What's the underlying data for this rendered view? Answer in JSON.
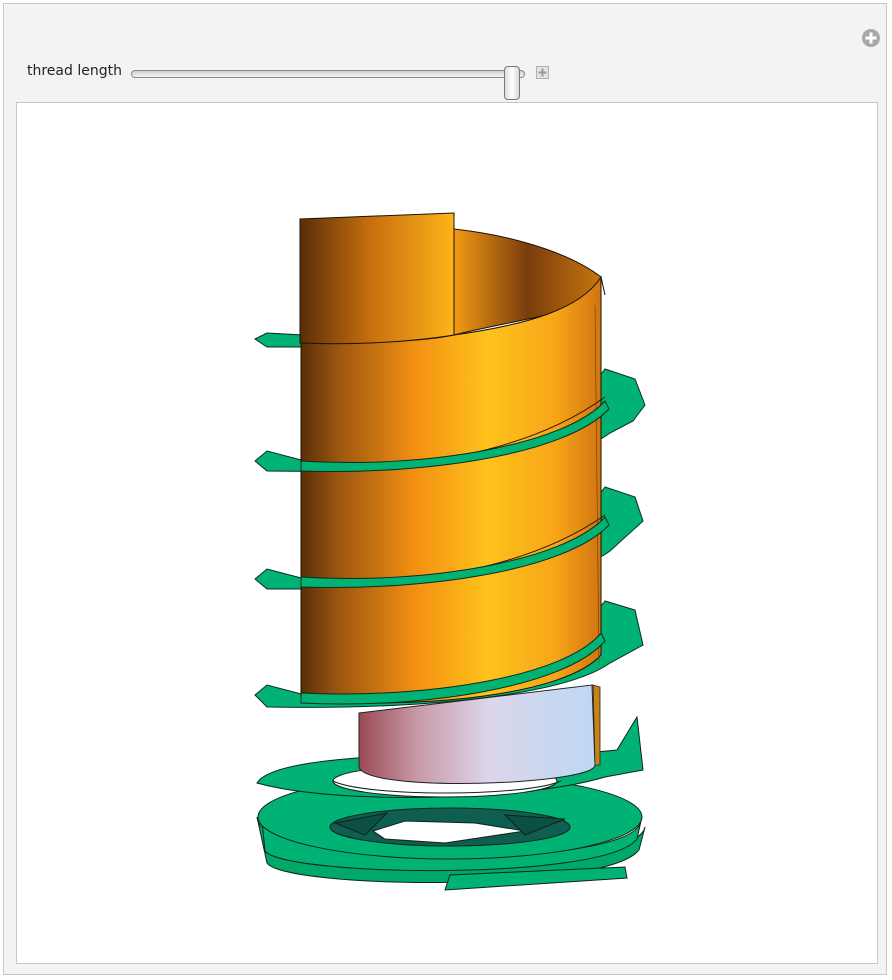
{
  "controls": {
    "thread_length_label": "thread length",
    "thread_length_value": 0.97
  },
  "icons": {
    "panel_options": "plus-circle-icon",
    "slider_expand": "plus-square-icon"
  },
  "colors": {
    "thread": "#00b374",
    "shell": "#f5a01a",
    "shank_left": "#a0505a",
    "shank_right": "#c4dcf6"
  }
}
